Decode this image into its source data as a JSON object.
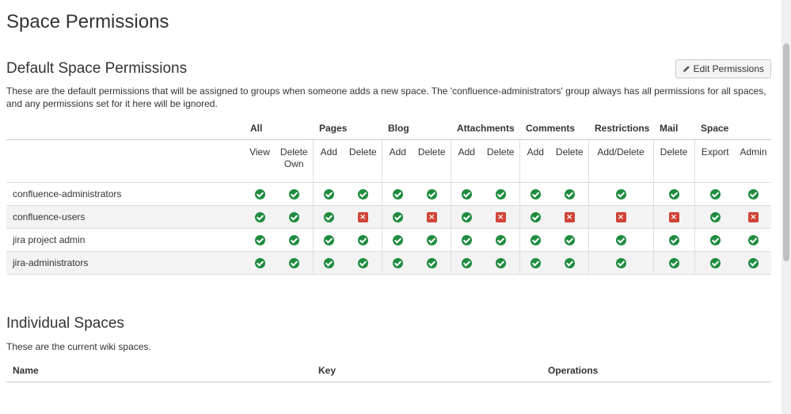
{
  "page": {
    "title": "Space Permissions"
  },
  "default_permissions": {
    "title": "Default Space Permissions",
    "edit_button": "Edit Permissions",
    "description": "These are the default permissions that will be assigned to groups when someone adds a new space. The 'confluence-administrators' group always has all permissions for all spaces, and any permissions set for it here will be ignored.",
    "groups": [
      {
        "label": "All",
        "span": 2
      },
      {
        "label": "Pages",
        "span": 2
      },
      {
        "label": "Blog",
        "span": 2
      },
      {
        "label": "Attachments",
        "span": 2
      },
      {
        "label": "Comments",
        "span": 2
      },
      {
        "label": "Restrictions",
        "span": 1
      },
      {
        "label": "Mail",
        "span": 1
      },
      {
        "label": "Space",
        "span": 2
      }
    ],
    "columns": [
      "View",
      "Delete Own",
      "Add",
      "Delete",
      "Add",
      "Delete",
      "Add",
      "Delete",
      "Add",
      "Delete",
      "Add/Delete",
      "Delete",
      "Export",
      "Admin"
    ],
    "rows": [
      {
        "name": "confluence-administrators",
        "perms": [
          true,
          true,
          true,
          true,
          true,
          true,
          true,
          true,
          true,
          true,
          true,
          true,
          true,
          true
        ]
      },
      {
        "name": "confluence-users",
        "perms": [
          true,
          true,
          true,
          false,
          true,
          false,
          true,
          false,
          true,
          false,
          false,
          false,
          true,
          false
        ]
      },
      {
        "name": "jira project admin",
        "perms": [
          true,
          true,
          true,
          true,
          true,
          true,
          true,
          true,
          true,
          true,
          true,
          true,
          true,
          true
        ]
      },
      {
        "name": "jira-administrators",
        "perms": [
          true,
          true,
          true,
          true,
          true,
          true,
          true,
          true,
          true,
          true,
          true,
          true,
          true,
          true
        ]
      }
    ]
  },
  "individual_spaces": {
    "title": "Individual Spaces",
    "description": "These are the current wiki spaces.",
    "columns": {
      "name": "Name",
      "key": "Key",
      "operations": "Operations"
    }
  },
  "icons": {
    "granted": "check-circle-icon",
    "denied": "cross-square-icon",
    "edit": "pencil-icon"
  },
  "colors": {
    "granted": "#1e8c3f",
    "denied": "#d04437",
    "alt_row": "#f3f3f3"
  }
}
